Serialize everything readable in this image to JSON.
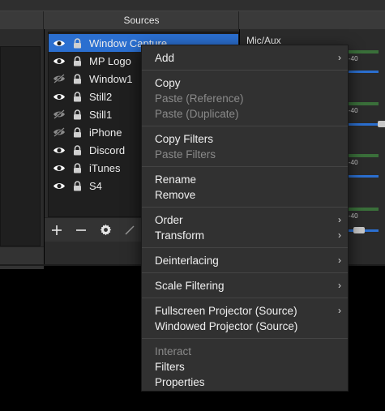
{
  "sources_dock": {
    "title": "Sources",
    "items": [
      {
        "name": "Window Capture",
        "visible": true,
        "selected": true
      },
      {
        "name": "MP Logo",
        "visible": true,
        "selected": false
      },
      {
        "name": "Window1",
        "visible": false,
        "selected": false
      },
      {
        "name": "Still2",
        "visible": true,
        "selected": false
      },
      {
        "name": "Still1",
        "visible": false,
        "selected": false
      },
      {
        "name": "iPhone",
        "visible": false,
        "selected": false
      },
      {
        "name": "Discord",
        "visible": true,
        "selected": false
      },
      {
        "name": "iTunes",
        "visible": true,
        "selected": false
      },
      {
        "name": "S4",
        "visible": true,
        "selected": false
      }
    ],
    "toolbar": {
      "add": "+",
      "remove": "—"
    }
  },
  "mixer": {
    "label": "Mic/Aux",
    "tick_label": "-40"
  },
  "context_menu": {
    "add": "Add",
    "copy": "Copy",
    "paste_reference": "Paste (Reference)",
    "paste_duplicate": "Paste (Duplicate)",
    "copy_filters": "Copy Filters",
    "paste_filters": "Paste Filters",
    "rename": "Rename",
    "remove": "Remove",
    "order": "Order",
    "transform": "Transform",
    "deinterlacing": "Deinterlacing",
    "scale_filtering": "Scale Filtering",
    "fullscreen_projector": "Fullscreen Projector (Source)",
    "windowed_projector": "Windowed Projector (Source)",
    "interact": "Interact",
    "filters": "Filters",
    "properties": "Properties",
    "submenu_arrow": "›"
  },
  "icons": {
    "visible": "eye-icon",
    "hidden": "eye-slash-icon",
    "lock": "lock-icon",
    "gear": "gear-icon"
  },
  "colors": {
    "selection": "#2b6fd0",
    "menu_bg": "#313131",
    "panel_bg": "#2b2b2b"
  }
}
